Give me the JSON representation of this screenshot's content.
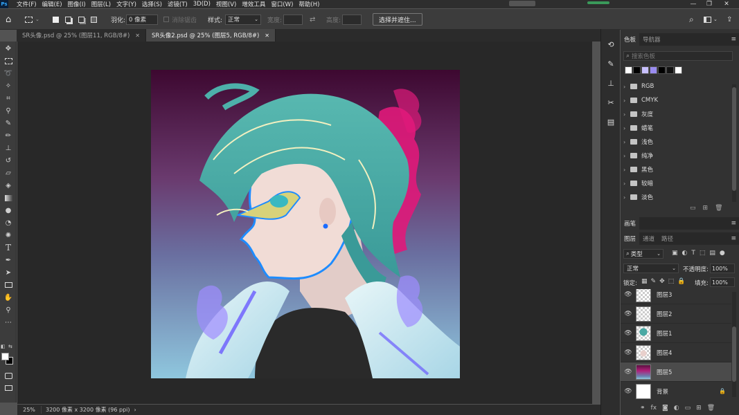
{
  "app_icon": "Ps",
  "menu": [
    "文件(F)",
    "编辑(E)",
    "图像(I)",
    "图层(L)",
    "文字(Y)",
    "选择(S)",
    "滤镜(T)",
    "3D(D)",
    "视图(V)",
    "增效工具",
    "窗口(W)",
    "帮助(H)"
  ],
  "options": {
    "feather_label": "羽化:",
    "feather_value": "0 像素",
    "antialias_label": "消除锯齿",
    "style_label": "样式:",
    "style_value": "正常",
    "width_label": "宽度:",
    "height_label": "高度:",
    "select_mask_button": "选择并遮住..."
  },
  "tabs": [
    {
      "label": "SR头像.psd @ 25% (图层11, RGB/8#)",
      "active": false
    },
    {
      "label": "SR头像2.psd @ 25% (图层5, RGB/8#)",
      "active": true
    }
  ],
  "status": {
    "zoom": "25%",
    "doc_size": "3200 像素 x 3200 像素 (96 ppi)"
  },
  "swatches_panel": {
    "tabs": [
      "色板",
      "导航器"
    ],
    "search_placeholder": "搜索色板",
    "recent_colors": [
      "#ffffff",
      "#000000",
      "#c8c0ff",
      "#9a8cf0",
      "#000000",
      "#111111",
      "#ffffff"
    ],
    "groups": [
      "RGB",
      "CMYK",
      "灰度",
      "蜡笔",
      "浅色",
      "纯净",
      "黑色",
      "较暗",
      "淡色"
    ]
  },
  "brush_panel": {
    "title": "画笔"
  },
  "layers_panel": {
    "tabs": [
      "图层",
      "通道",
      "路径"
    ],
    "filter_kind": "类型",
    "blend_mode": "正常",
    "opacity_label": "不透明度:",
    "opacity_value": "100%",
    "lock_label": "锁定:",
    "fill_label": "填充:",
    "fill_value": "100%",
    "layers": [
      {
        "name": "图层3",
        "selected": false
      },
      {
        "name": "图层2",
        "selected": false
      },
      {
        "name": "图层1",
        "selected": false
      },
      {
        "name": "图层4",
        "selected": false
      },
      {
        "name": "图层5",
        "selected": true
      },
      {
        "name": "背景",
        "selected": false
      }
    ]
  },
  "colors": {
    "accent": "#31a8ff",
    "bg_dark": "#282828",
    "panel": "#323232"
  }
}
